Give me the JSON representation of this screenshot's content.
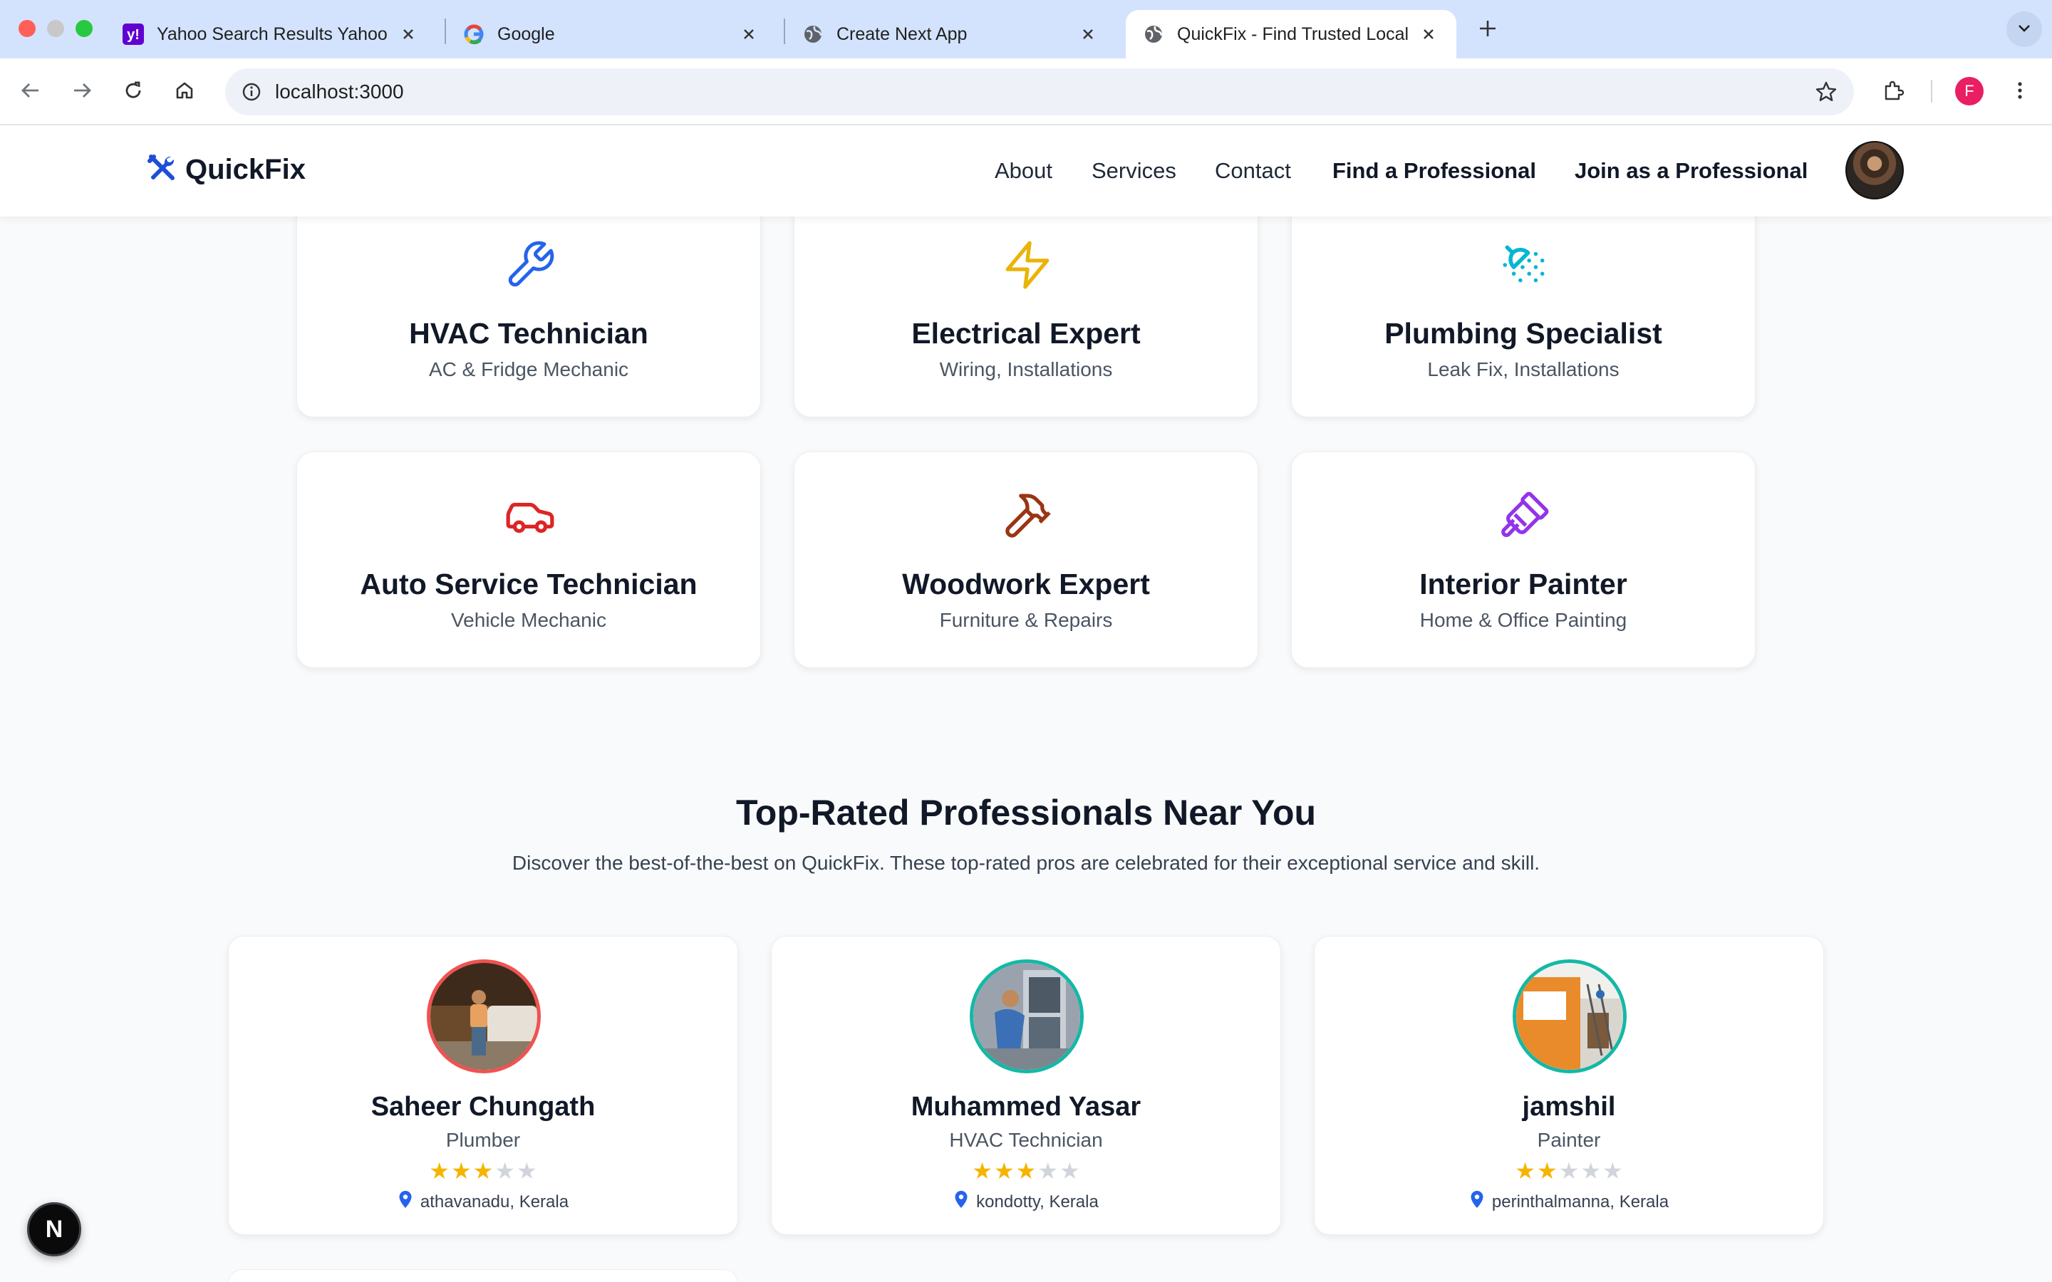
{
  "browser": {
    "tabs": [
      {
        "title": "Yahoo Search Results Yahoo Search Results",
        "favicon": "yahoo-icon"
      },
      {
        "title": "Google",
        "favicon": "google-icon"
      },
      {
        "title": "Create Next App",
        "favicon": "globe-icon"
      },
      {
        "title": "QuickFix - Find Trusted Local Professionals",
        "favicon": "globe-icon",
        "active": true
      }
    ],
    "url": "localhost:3000",
    "profile_initial": "F"
  },
  "header": {
    "brand": "QuickFix",
    "nav": {
      "about": "About",
      "services": "Services",
      "contact": "Contact",
      "find": "Find a Professional",
      "join": "Join as a Professional"
    }
  },
  "services": [
    {
      "name": "HVAC Technician",
      "sub": "AC & Fridge Mechanic",
      "icon": "wrench-icon",
      "color": "#2563eb"
    },
    {
      "name": "Electrical Expert",
      "sub": "Wiring, Installations",
      "icon": "lightning-icon",
      "color": "#eab308"
    },
    {
      "name": "Plumbing Specialist",
      "sub": "Leak Fix, Installations",
      "icon": "shower-icon",
      "color": "#06b6d4"
    },
    {
      "name": "Auto Service Technician",
      "sub": "Vehicle Mechanic",
      "icon": "car-icon",
      "color": "#dc2626"
    },
    {
      "name": "Woodwork Expert",
      "sub": "Furniture & Repairs",
      "icon": "hammer-icon",
      "color": "#9a3412"
    },
    {
      "name": "Interior Painter",
      "sub": "Home & Office Painting",
      "icon": "paintbrush-icon",
      "color": "#9333ea"
    }
  ],
  "top_rated": {
    "title": "Top-Rated Professionals Near You",
    "description": "Discover the best-of-the-best on QuickFix. These top-rated pros are celebrated for their exceptional service and skill.",
    "pros": [
      {
        "name": "Saheer Chungath",
        "role": "Plumber",
        "rating": 3,
        "max": 5,
        "location": "athavanadu, Kerala"
      },
      {
        "name": "Muhammed Yasar",
        "role": "HVAC Technician",
        "rating": 3,
        "max": 5,
        "location": "kondotty, Kerala"
      },
      {
        "name": "jamshil",
        "role": "Painter",
        "rating": 2,
        "max": 5,
        "location": "perinthalmanna, Kerala"
      }
    ]
  },
  "colors": {
    "star_filled": "#f5b400",
    "star_empty": "#d1d5db",
    "accent": "#1d4ed8",
    "pin": "#2563eb"
  },
  "dev_badge": "N"
}
